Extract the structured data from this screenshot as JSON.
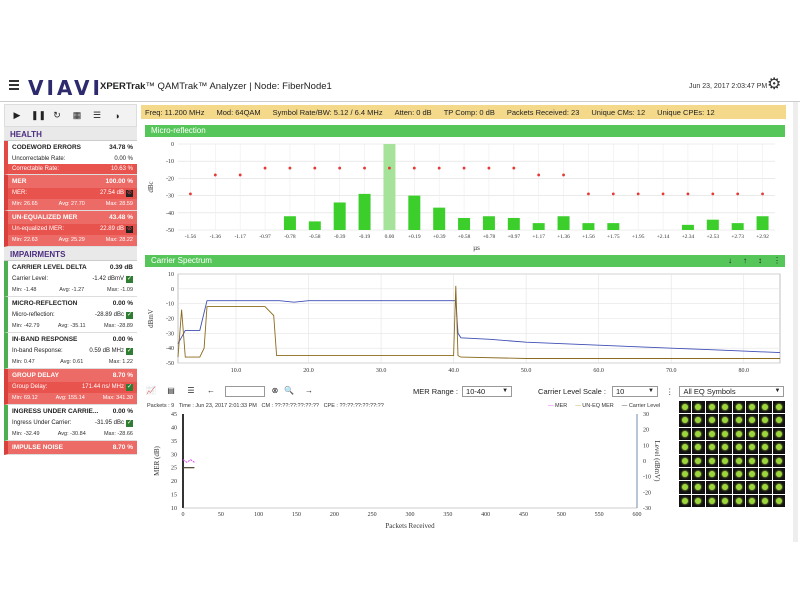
{
  "header": {
    "logo": "VIAVI",
    "title_bold": "XPERTrak",
    "title_rest": "™ QAMTrak™ Analyzer | Node: FiberNode1",
    "datetime": "Jun 23, 2017 2:03:47 PM"
  },
  "sections": {
    "health": "HEALTH",
    "impairments": "IMPAIRMENTS"
  },
  "health": {
    "codeword": {
      "label": "CODEWORD ERRORS",
      "value": "34.78 %",
      "row1_label": "Uncorrectable Rate:",
      "row1_value": "0.00 %",
      "row2_label": "Correctable Rate:",
      "row2_value": "10.63 %"
    },
    "mer": {
      "label": "MER",
      "value": "100.00 %",
      "row_label": "MER:",
      "row_value": "27.54 dB",
      "min": "Min: 26.65",
      "avg": "Avg: 27.70",
      "max": "Max: 28.59"
    },
    "uneq_mer": {
      "label": "UN-EQUALIZED MER",
      "value": "43.48 %",
      "row_label": "Un-equalized MER:",
      "row_value": "22.89 dB",
      "min": "Min: 22.63",
      "avg": "Avg: 25.29",
      "max": "Max: 28.22"
    }
  },
  "impairments": {
    "carrier": {
      "label": "CARRIER LEVEL DELTA",
      "value": "0.39 dB",
      "row_label": "Carrier Level:",
      "row_value": "-1.42 dBmV",
      "min": "Min: -1.48",
      "avg": "Avg: -1.27",
      "max": "Max: -1.09"
    },
    "micro": {
      "label": "MICRO-REFLECTION",
      "value": "0.00 %",
      "row_label": "Micro-reflection:",
      "row_value": "-28.89 dBc",
      "min": "Min: -42.79",
      "avg": "Avg: -35.11",
      "max": "Max: -28.89"
    },
    "inband": {
      "label": "IN-BAND RESPONSE",
      "value": "0.00 %",
      "row_label": "In-band Response:",
      "row_value": "0.59 dB MHz",
      "min": "Min: 0.47",
      "avg": "Avg: 0.61",
      "max": "Max: 1.22"
    },
    "group": {
      "label": "GROUP DELAY",
      "value": "8.70 %",
      "row_label": "Group Delay:",
      "row_value": "171.44 ns/ MHz",
      "min": "Min: 69.12",
      "avg": "Avg: 155.14",
      "max": "Max: 341.30"
    },
    "ingress": {
      "label": "INGRESS UNDER CARRIE...",
      "value": "0.00 %",
      "row_label": "Ingress Under Carrier:",
      "row_value": "-31.95 dBc",
      "min": "Min: -32.49",
      "avg": "Avg: -30.84",
      "max": "Max: -28.66"
    },
    "impulse": {
      "label": "IMPULSE NOISE",
      "value": "8.70 %"
    }
  },
  "infobar": {
    "freq": "Freq: 11.200 MHz",
    "mod": "Mod: 64QAM",
    "symrate": "Symbol Rate/BW: 5.12 / 6.4 MHz",
    "atten": "Atten: 0 dB",
    "tpcomp": "TP Comp: 0 dB",
    "packets": "Packets Received: 23",
    "cms": "Unique CMs: 12",
    "cpes": "Unique CPEs: 12"
  },
  "panels": {
    "micro": "Micro-reflection",
    "spectrum": "Carrier Spectrum"
  },
  "toolbar": {
    "mer_range_label": "MER Range :",
    "mer_range_value": "10-40",
    "carrier_scale_label": "Carrier Level Scale :",
    "carrier_scale_value": "10",
    "eq_select": "All EQ Symbols"
  },
  "packet_info": {
    "packets": "Packets : 9",
    "time": "Time : Jun 23, 2017 2:01:33 PM",
    "cm": "CM : ??:??:??:??:??:??",
    "cpe": "CPE : ??:??:??:??:??:??"
  },
  "legend": {
    "mer": "MER",
    "uneq": "UN-EQ MER",
    "carrier": "Carrier Level"
  },
  "colors": {
    "mer": "#e040fb",
    "uneq": "#c8a02a",
    "carrier": "#333333",
    "bar": "#3ccf2b",
    "dot": "#e53935"
  },
  "chart_data": [
    {
      "type": "bar",
      "title": "Micro-reflection",
      "ylabel": "dBc",
      "xlabel": "µs",
      "ylim": [
        -50,
        0
      ],
      "yticks": [
        "0",
        "-10",
        "-20",
        "-30",
        "-40",
        "-50"
      ],
      "categories": [
        "-1.56",
        "-1.36",
        "-1.17",
        "-0.97",
        "-0.78",
        "-0.58",
        "-0.39",
        "-0.19",
        "0.00",
        "+0.19",
        "+0.39",
        "+0.58",
        "+0.78",
        "+0.97",
        "+1.17",
        "+1.36",
        "+1.56",
        "+1.75",
        "+1.95",
        "+2.14",
        "+2.34",
        "+2.53",
        "+2.73",
        "+2.92"
      ],
      "values": [
        null,
        null,
        null,
        null,
        -42,
        -45,
        -34,
        -29,
        0,
        -30,
        -37,
        -43,
        -42,
        -43,
        -46,
        -42,
        -46,
        -46,
        null,
        null,
        -47,
        -44,
        -46,
        -42
      ],
      "thresholds": [
        -29,
        -18,
        -18,
        -14,
        -14,
        -14,
        -14,
        -14,
        -14,
        -14,
        -14,
        -14,
        -14,
        -14,
        -18,
        -18,
        -29,
        -29,
        -29,
        -29,
        -29,
        -29,
        -29,
        -29
      ]
    },
    {
      "type": "line",
      "title": "Carrier Spectrum",
      "ylabel": "dBmV",
      "ylim": [
        -50,
        10
      ],
      "yticks": [
        "10",
        "0",
        "-10",
        "-20",
        "-30",
        "-40",
        "-50"
      ],
      "xticks": [
        "10.0",
        "20.0",
        "30.0",
        "40.0",
        "50.0",
        "60.0",
        "70.0",
        "80.0"
      ],
      "xlim": [
        2,
        85
      ],
      "series": [
        {
          "name": "",
          "x": [
            2,
            3,
            5,
            5.6,
            6,
            10,
            14,
            15,
            16,
            18,
            20,
            22,
            26,
            30,
            34,
            38,
            40,
            40.3,
            40.6,
            41,
            45,
            50,
            55,
            60,
            65,
            70,
            75,
            80,
            85
          ],
          "values": [
            -37,
            -28,
            -28,
            -16,
            -8,
            -8,
            -8,
            -8,
            -8,
            -9,
            -8,
            -8,
            -8,
            -8,
            -8,
            -8,
            -8,
            -8,
            -30,
            -33,
            -34,
            -36,
            -37,
            -38,
            -39,
            -40,
            -41,
            -42,
            -43
          ]
        },
        {
          "name": "",
          "x": [
            2,
            2.5,
            3,
            3.4,
            4,
            5,
            5.6,
            6,
            10,
            14,
            15.2,
            15.6,
            20,
            40,
            40.3,
            40.6,
            41,
            50,
            60,
            70,
            85
          ],
          "values": [
            -46,
            -14,
            -46,
            -46,
            -46,
            -46,
            -40,
            -12,
            -12,
            -12,
            -18,
            -45,
            -45,
            -45,
            2,
            -45,
            -46,
            -47,
            -47,
            -47,
            -47
          ]
        }
      ]
    },
    {
      "type": "scatter",
      "xlabel": "Packets Received",
      "ylabel": "MER (dB)",
      "y2label": "Level (dBmV)",
      "xlim": [
        0,
        600
      ],
      "xticks": [
        "0",
        "50",
        "100",
        "150",
        "200",
        "250",
        "300",
        "350",
        "400",
        "450",
        "500",
        "550",
        "600"
      ],
      "yticks": [
        "45",
        "40",
        "35",
        "30",
        "25",
        "20",
        "15",
        "10"
      ],
      "y2ticks": [
        "30",
        "20",
        "10",
        "0",
        "-10",
        "-20",
        "-30"
      ],
      "series": [
        {
          "name": "MER",
          "x": [
            0,
            5,
            10,
            15
          ],
          "values": [
            28,
            27,
            28,
            27
          ]
        },
        {
          "name": "UN-EQ MER",
          "x": [
            0,
            5,
            10,
            15
          ],
          "values": [
            25,
            25,
            25,
            25
          ]
        },
        {
          "name": "Carrier Level",
          "x": [
            0,
            5,
            10,
            15
          ],
          "values": [
            25,
            25,
            25,
            25
          ]
        }
      ]
    }
  ]
}
